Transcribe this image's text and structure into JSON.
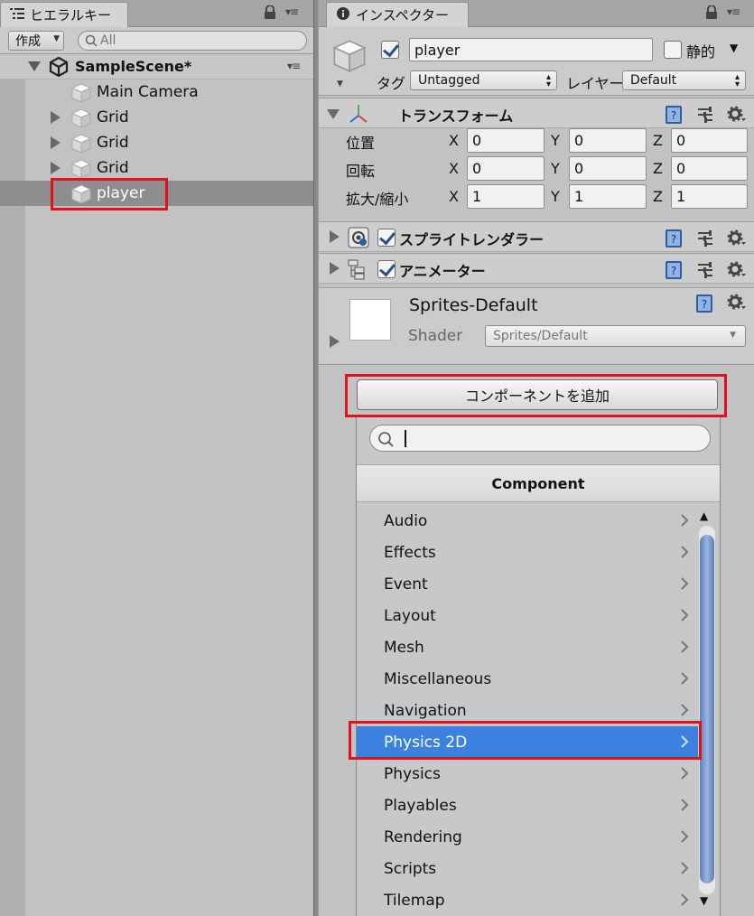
{
  "hierarchy": {
    "tab_label": "ヒエラルキー",
    "create_label": "作成",
    "search_placeholder": "All",
    "scene_name": "SampleScene*",
    "items": [
      {
        "label": "Main Camera"
      },
      {
        "label": "Grid"
      },
      {
        "label": "Grid"
      },
      {
        "label": "Grid"
      },
      {
        "label": "player"
      }
    ]
  },
  "inspector": {
    "tab_label": "インスペクター",
    "object_name": "player",
    "active": true,
    "static_label": "静的",
    "tag_label": "タグ",
    "tag_value": "Untagged",
    "layer_label": "レイヤー",
    "layer_value": "Default",
    "transform": {
      "title": "トランスフォーム",
      "rows": [
        {
          "label": "位置",
          "x": "0",
          "y": "0",
          "z": "0"
        },
        {
          "label": "回転",
          "x": "0",
          "y": "0",
          "z": "0"
        },
        {
          "label": "拡大/縮小",
          "x": "1",
          "y": "1",
          "z": "1"
        }
      ],
      "axis_x": "X",
      "axis_y": "Y",
      "axis_z": "Z"
    },
    "components": [
      {
        "title": "スプライトレンダラー",
        "enabled": true
      },
      {
        "title": "アニメーター",
        "enabled": true
      }
    ],
    "material": {
      "name": "Sprites-Default",
      "shader_label": "Shader",
      "shader_value": "Sprites/Default"
    },
    "add_component_label": "コンポーネントを追加"
  },
  "component_popup": {
    "search_value": "",
    "header": "Component",
    "items": [
      {
        "label": "Audio"
      },
      {
        "label": "Effects"
      },
      {
        "label": "Event"
      },
      {
        "label": "Layout"
      },
      {
        "label": "Mesh"
      },
      {
        "label": "Miscellaneous"
      },
      {
        "label": "Navigation"
      },
      {
        "label": "Physics 2D",
        "selected": true
      },
      {
        "label": "Physics"
      },
      {
        "label": "Playables"
      },
      {
        "label": "Rendering"
      },
      {
        "label": "Scripts"
      },
      {
        "label": "Tilemap"
      }
    ]
  },
  "colors": {
    "selection_blue": "#3b82e0",
    "highlight_red": "#e0121e",
    "panel_gray": "#c2c2c2"
  }
}
